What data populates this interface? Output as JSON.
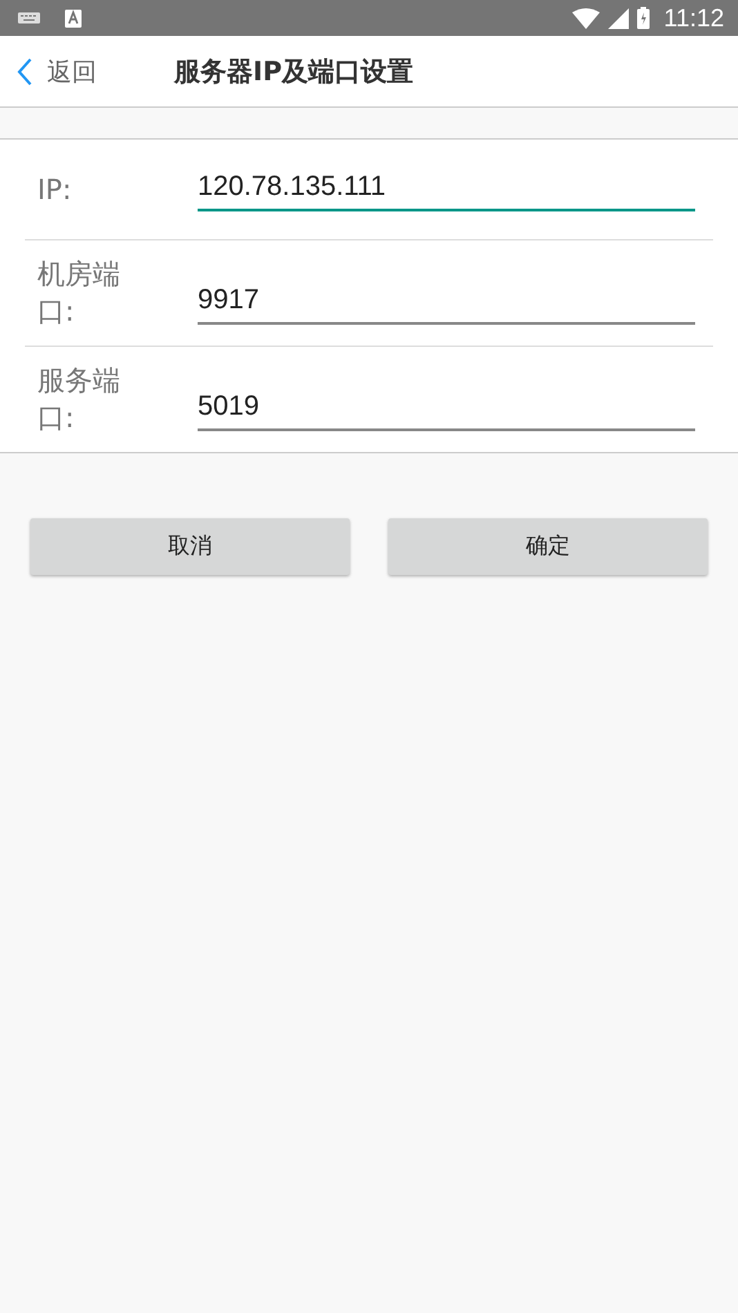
{
  "status_bar": {
    "time": "11:12"
  },
  "header": {
    "back": "返回",
    "title": "服务器IP及端口设置"
  },
  "fields": [
    {
      "label": "IP:",
      "value": "120.78.135.111",
      "focused": true
    },
    {
      "label": "机房端口:",
      "value": "9917",
      "focused": false
    },
    {
      "label": "服务端口:",
      "value": "5019",
      "focused": false
    }
  ],
  "buttons": [
    "取消",
    "确定"
  ]
}
